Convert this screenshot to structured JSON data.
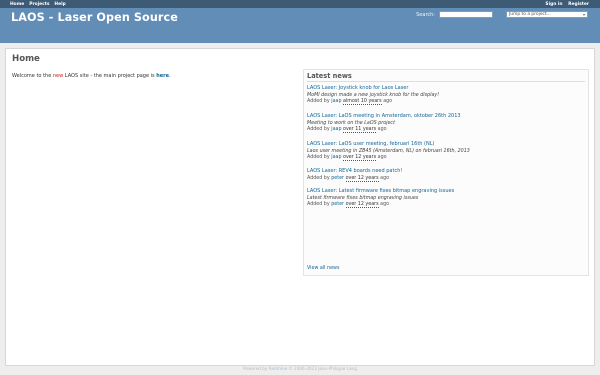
{
  "top_menu": {
    "left": [
      "Home",
      "Projects",
      "Help"
    ],
    "right": [
      "Sign in",
      "Register"
    ]
  },
  "header": {
    "title": "LAOS - Laser Open Source",
    "search_label": "Search:",
    "search_value": "",
    "jump_select": "Jump to a project..."
  },
  "page": {
    "title": "Home",
    "welcome_pre": "Welcome to the ",
    "welcome_new": "new",
    "welcome_mid": " LAOS site - the main project page is ",
    "welcome_link": "here",
    "welcome_post": "."
  },
  "news": {
    "heading": "Latest news",
    "items": [
      {
        "title": "LAOS Laser: Joystick knob for Laos Laser",
        "summary": "MoMI design made a new joystick knob for the display!",
        "added_by": "Added by",
        "user": "jaap",
        "when": "almost 10 years",
        "ago": "ago"
      },
      {
        "title": "LAOS Laser: LaOS meeting in Amsterdam, oktober 26th 2013",
        "summary": "Meeting to work on the LaOS project",
        "added_by": "Added by",
        "user": "jaap",
        "when": "over 11 years",
        "ago": "ago"
      },
      {
        "title": "LAOS Laser: LaOS user meeting, februari 16th (NL)",
        "summary": "Laos user meeting in ZB45 (Amsterdam, NL) on februari 16th, 2013",
        "added_by": "Added by",
        "user": "jaap",
        "when": "over 12 years",
        "ago": "ago"
      },
      {
        "title": "LAOS Laser: REV4 boards need patch!",
        "summary": "",
        "added_by": "Added by",
        "user": "peter",
        "when": "over 12 years",
        "ago": "ago"
      },
      {
        "title": "LAOS Laser: Latest firmware fixes bitmap engraving issues",
        "summary": "Latest firmware fixes bitmap engraving issues",
        "added_by": "Added by",
        "user": "peter",
        "when": "over 12 years",
        "ago": "ago"
      }
    ],
    "view_all": "View all news"
  },
  "footer": {
    "powered_by": "Powered by",
    "link": "Redmine",
    "copyright": "© 2006-2023 Jean-Philippe Lang"
  }
}
